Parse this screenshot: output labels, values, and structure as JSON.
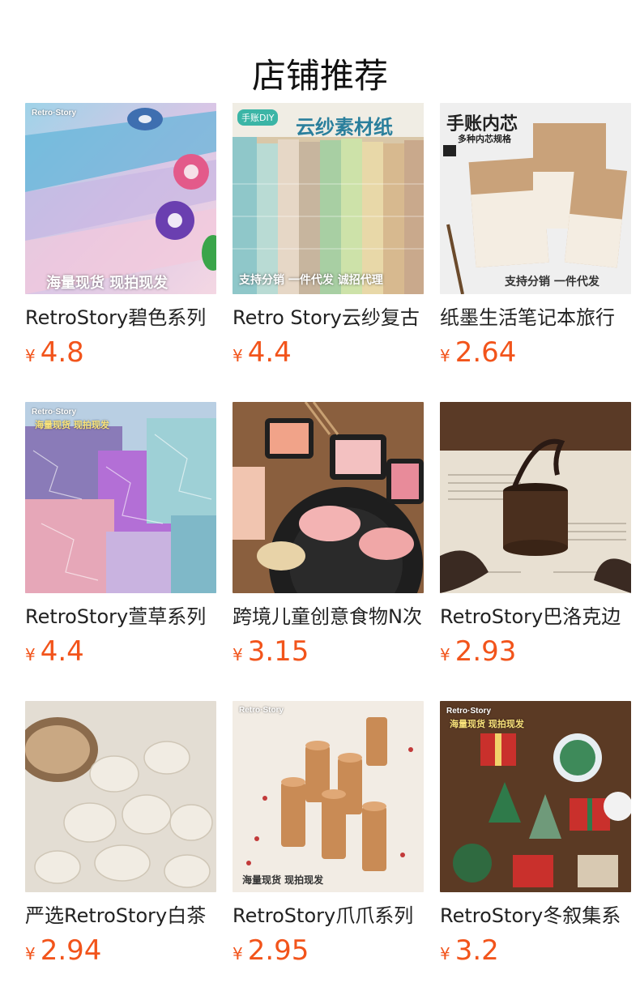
{
  "section": {
    "title": "店铺推荐"
  },
  "currency_symbol": "¥",
  "products": [
    {
      "name": "RetroStory碧色系列",
      "price": "4.8",
      "image_brand": "Retro·Story",
      "image_text": "海量现货 现拍现发"
    },
    {
      "name": "Retro Story云纱复古",
      "price": "4.4",
      "image_badge": "手账DIY",
      "image_title": "云纱素材纸",
      "image_text": "支持分销 一件代发 诚招代理"
    },
    {
      "name": "纸墨生活笔记本旅行",
      "price": "2.64",
      "image_title": "手账内芯",
      "image_subtitle": "多种内芯规格",
      "image_text": "支持分销 一件代发"
    },
    {
      "name": "RetroStory萱草系列",
      "price": "4.4",
      "image_brand": "Retro·Story",
      "image_text": "海量现货 现拍现发"
    },
    {
      "name": "跨境儿童创意食物N次",
      "price": "3.15"
    },
    {
      "name": "RetroStory巴洛克边",
      "price": "2.93"
    },
    {
      "name": "严选RetroStory白茶",
      "price": "2.94"
    },
    {
      "name": "RetroStory爪爪系列",
      "price": "2.95",
      "image_brand": "Retro·Story",
      "image_text": "海量现货 现拍现发"
    },
    {
      "name": "RetroStory冬叙集系",
      "price": "3.2",
      "image_brand": "Retro·Story",
      "image_text": "海量现货 现拍现发"
    }
  ],
  "colors": {
    "price": "#f2541b",
    "title": "#111111",
    "name": "#222222"
  }
}
